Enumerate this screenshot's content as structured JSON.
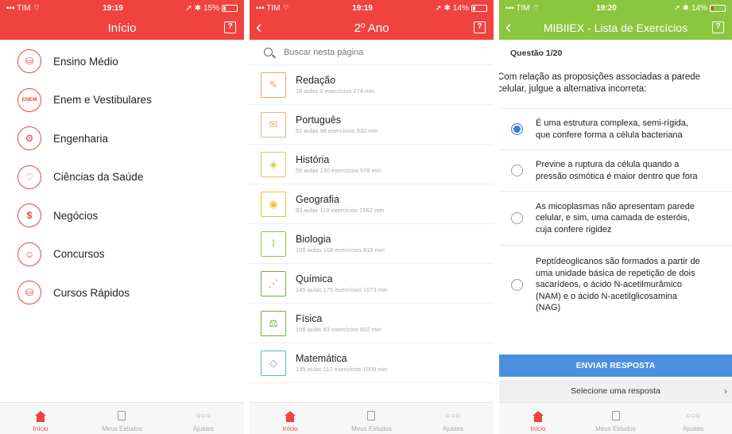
{
  "colors": {
    "brand_red": "#f0433f",
    "quiz_green": "#8cc63f",
    "send_blue": "#4a8fe0",
    "tab_inactive": "#a9a9a9"
  },
  "status1": {
    "carrier": "TIM",
    "time": "19:19",
    "battery": "15%"
  },
  "status2": {
    "carrier": "TIM",
    "time": "19:19",
    "battery": "14%"
  },
  "status3": {
    "carrier": "TIM",
    "time": "19:20",
    "battery": "14%"
  },
  "screen1": {
    "title": "Início",
    "help_label": "?",
    "items": [
      {
        "label": "Ensino Médio",
        "icon": "backpack-icon",
        "glyph": "⛁"
      },
      {
        "label": "Enem e Vestibulares",
        "icon": "enem-icon",
        "glyph": "ENEM"
      },
      {
        "label": "Engenharia",
        "icon": "gears-icon",
        "glyph": "⚙"
      },
      {
        "label": "Ciências da Saúde",
        "icon": "heart-icon",
        "glyph": "♡"
      },
      {
        "label": "Negócios",
        "icon": "money-icon",
        "glyph": "$"
      },
      {
        "label": "Concursos",
        "icon": "head-icon",
        "glyph": "☺"
      },
      {
        "label": "Cursos Rápidos",
        "icon": "backpack-icon",
        "glyph": "⛁"
      }
    ]
  },
  "screen2": {
    "title": "2º Ano",
    "help_label": "?",
    "search_placeholder": "Buscar nesta página",
    "items": [
      {
        "title": "Redação",
        "sub": "18 aulas 0 exercícios 274 min",
        "color": "#f0a070",
        "glyph": "✎"
      },
      {
        "title": "Português",
        "sub": "51 aulas 98 exercícios 532 min",
        "color": "#f0b080",
        "glyph": "✉"
      },
      {
        "title": "História",
        "sub": "55 aulas 130 exercícios 578 min",
        "color": "#f0c060",
        "glyph": "◈"
      },
      {
        "title": "Geografia",
        "sub": "93 aulas 119 exercícios 1562 min",
        "color": "#f0c030",
        "glyph": "◉"
      },
      {
        "title": "Biologia",
        "sub": "100 aulas 168 exercícios 919 min",
        "color": "#8cc63f",
        "glyph": "⌇"
      },
      {
        "title": "Química",
        "sub": "145 aulas 175 exercícios 1073 min",
        "color": "#6ab040",
        "glyph": "⋰"
      },
      {
        "title": "Física",
        "sub": "106 aulas 83 exercícios 802 min",
        "color": "#6ab040",
        "glyph": "⚖"
      },
      {
        "title": "Matemática",
        "sub": "135 aulas 112 exercícios 1008 min",
        "color": "#60b0e0",
        "glyph": "◇"
      }
    ]
  },
  "screen3": {
    "title": "MIBIIEX - Lista de Exercícios",
    "help_label": "?",
    "question_number": "Questão 1/20",
    "question_lines": [
      "Com relação as proposições associadas a parede",
      "celular, julgue a alternativa incorreta:"
    ],
    "options": [
      {
        "lines": [
          "É uma estrutura complexa, semi-rígida,",
          "que confere forma a célula bacteriana"
        ],
        "selected": true
      },
      {
        "lines": [
          "Previne a ruptura da célula quando a",
          "pressão osmótica é maior dentro que fora"
        ],
        "selected": false
      },
      {
        "lines": [
          "As micoplasmas não apresentam parede",
          "celular, e sim, uma camada de esteróis,",
          "cuja confere rigidez"
        ],
        "selected": false
      },
      {
        "lines": [
          "Peptídeoglicanos são formados a partir de",
          "uma unidade básica de repetição de dois",
          "sacarídeos, o ácido N-acetilmurâmico",
          "(NAM) e o ácido N-acetilglicosamina",
          "(NAG)"
        ],
        "selected": false
      }
    ],
    "send_label": "ENVIAR RESPOSTA",
    "select_label": "Selecione uma resposta",
    "select_chevron": "›"
  },
  "tabs": [
    {
      "label": "Início",
      "icon": "home-icon",
      "active": true
    },
    {
      "label": "Meus Estudos",
      "icon": "book-icon",
      "active": false
    },
    {
      "label": "Ajustes",
      "icon": "more-dots-icon",
      "glyph": "○○○",
      "active": false
    }
  ]
}
